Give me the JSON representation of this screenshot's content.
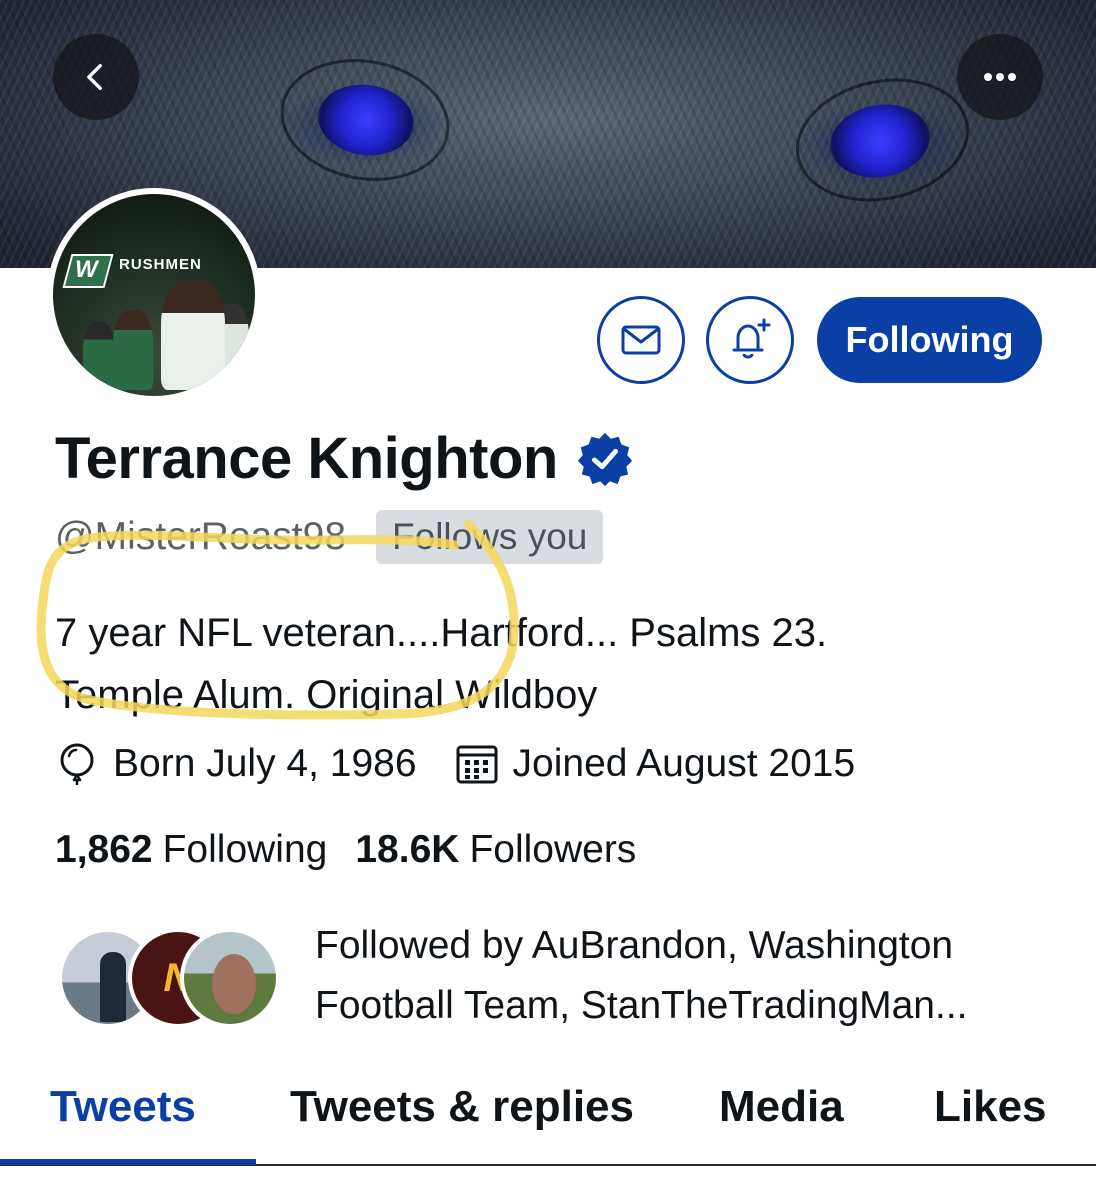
{
  "profile": {
    "display_name": "Terrance Knighton",
    "handle": "@MisterRoast98",
    "follows_you_label": "Follows you",
    "bio_line1": "7 year NFL veteran....Hartford... Psalms 23.",
    "bio_line2": "Temple Alum. Original Wildboy",
    "born": "Born July 4, 1986",
    "joined": "Joined August 2015",
    "avatar_caption": "RUSHMEN",
    "avatar_logo": "W"
  },
  "actions": {
    "following_label": "Following"
  },
  "stats": {
    "following_count": "1,862",
    "following_label": "Following",
    "followers_count": "18.6K",
    "followers_label": "Followers"
  },
  "followed_by": {
    "text": "Followed by AuBrandon, Washington Football Team, StanTheTradingMan...",
    "badge_letter": "N"
  },
  "tabs": [
    {
      "label": "Tweets",
      "active": true
    },
    {
      "label": "Tweets & replies",
      "active": false
    },
    {
      "label": "Media",
      "active": false
    },
    {
      "label": "Likes",
      "active": false
    }
  ],
  "colors": {
    "accent": "#0a3fa5",
    "highlight": "#f5d75a"
  },
  "icons": [
    "back-icon",
    "more-icon",
    "mail-icon",
    "bell-plus-icon",
    "verified-icon",
    "birthday-icon",
    "calendar-icon"
  ]
}
